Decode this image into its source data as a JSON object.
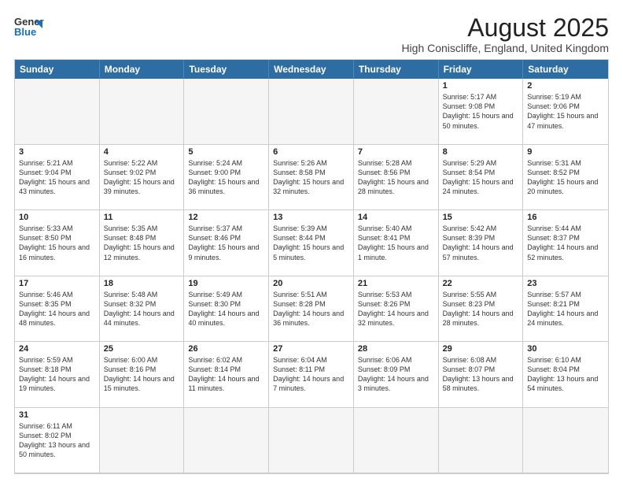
{
  "header": {
    "logo_line1": "General",
    "logo_line2": "Blue",
    "main_title": "August 2025",
    "subtitle": "High Coniscliffe, England, United Kingdom"
  },
  "day_headers": [
    "Sunday",
    "Monday",
    "Tuesday",
    "Wednesday",
    "Thursday",
    "Friday",
    "Saturday"
  ],
  "cells": [
    {
      "day": "",
      "info": "",
      "empty": true
    },
    {
      "day": "",
      "info": "",
      "empty": true
    },
    {
      "day": "",
      "info": "",
      "empty": true
    },
    {
      "day": "",
      "info": "",
      "empty": true
    },
    {
      "day": "",
      "info": "",
      "empty": true
    },
    {
      "day": "1",
      "info": "Sunrise: 5:17 AM\nSunset: 9:08 PM\nDaylight: 15 hours and 50 minutes."
    },
    {
      "day": "2",
      "info": "Sunrise: 5:19 AM\nSunset: 9:06 PM\nDaylight: 15 hours and 47 minutes."
    },
    {
      "day": "3",
      "info": "Sunrise: 5:21 AM\nSunset: 9:04 PM\nDaylight: 15 hours and 43 minutes."
    },
    {
      "day": "4",
      "info": "Sunrise: 5:22 AM\nSunset: 9:02 PM\nDaylight: 15 hours and 39 minutes."
    },
    {
      "day": "5",
      "info": "Sunrise: 5:24 AM\nSunset: 9:00 PM\nDaylight: 15 hours and 36 minutes."
    },
    {
      "day": "6",
      "info": "Sunrise: 5:26 AM\nSunset: 8:58 PM\nDaylight: 15 hours and 32 minutes."
    },
    {
      "day": "7",
      "info": "Sunrise: 5:28 AM\nSunset: 8:56 PM\nDaylight: 15 hours and 28 minutes."
    },
    {
      "day": "8",
      "info": "Sunrise: 5:29 AM\nSunset: 8:54 PM\nDaylight: 15 hours and 24 minutes."
    },
    {
      "day": "9",
      "info": "Sunrise: 5:31 AM\nSunset: 8:52 PM\nDaylight: 15 hours and 20 minutes."
    },
    {
      "day": "10",
      "info": "Sunrise: 5:33 AM\nSunset: 8:50 PM\nDaylight: 15 hours and 16 minutes."
    },
    {
      "day": "11",
      "info": "Sunrise: 5:35 AM\nSunset: 8:48 PM\nDaylight: 15 hours and 12 minutes."
    },
    {
      "day": "12",
      "info": "Sunrise: 5:37 AM\nSunset: 8:46 PM\nDaylight: 15 hours and 9 minutes."
    },
    {
      "day": "13",
      "info": "Sunrise: 5:39 AM\nSunset: 8:44 PM\nDaylight: 15 hours and 5 minutes."
    },
    {
      "day": "14",
      "info": "Sunrise: 5:40 AM\nSunset: 8:41 PM\nDaylight: 15 hours and 1 minute."
    },
    {
      "day": "15",
      "info": "Sunrise: 5:42 AM\nSunset: 8:39 PM\nDaylight: 14 hours and 57 minutes."
    },
    {
      "day": "16",
      "info": "Sunrise: 5:44 AM\nSunset: 8:37 PM\nDaylight: 14 hours and 52 minutes."
    },
    {
      "day": "17",
      "info": "Sunrise: 5:46 AM\nSunset: 8:35 PM\nDaylight: 14 hours and 48 minutes."
    },
    {
      "day": "18",
      "info": "Sunrise: 5:48 AM\nSunset: 8:32 PM\nDaylight: 14 hours and 44 minutes."
    },
    {
      "day": "19",
      "info": "Sunrise: 5:49 AM\nSunset: 8:30 PM\nDaylight: 14 hours and 40 minutes."
    },
    {
      "day": "20",
      "info": "Sunrise: 5:51 AM\nSunset: 8:28 PM\nDaylight: 14 hours and 36 minutes."
    },
    {
      "day": "21",
      "info": "Sunrise: 5:53 AM\nSunset: 8:26 PM\nDaylight: 14 hours and 32 minutes."
    },
    {
      "day": "22",
      "info": "Sunrise: 5:55 AM\nSunset: 8:23 PM\nDaylight: 14 hours and 28 minutes."
    },
    {
      "day": "23",
      "info": "Sunrise: 5:57 AM\nSunset: 8:21 PM\nDaylight: 14 hours and 24 minutes."
    },
    {
      "day": "24",
      "info": "Sunrise: 5:59 AM\nSunset: 8:18 PM\nDaylight: 14 hours and 19 minutes."
    },
    {
      "day": "25",
      "info": "Sunrise: 6:00 AM\nSunset: 8:16 PM\nDaylight: 14 hours and 15 minutes."
    },
    {
      "day": "26",
      "info": "Sunrise: 6:02 AM\nSunset: 8:14 PM\nDaylight: 14 hours and 11 minutes."
    },
    {
      "day": "27",
      "info": "Sunrise: 6:04 AM\nSunset: 8:11 PM\nDaylight: 14 hours and 7 minutes."
    },
    {
      "day": "28",
      "info": "Sunrise: 6:06 AM\nSunset: 8:09 PM\nDaylight: 14 hours and 3 minutes."
    },
    {
      "day": "29",
      "info": "Sunrise: 6:08 AM\nSunset: 8:07 PM\nDaylight: 13 hours and 58 minutes."
    },
    {
      "day": "30",
      "info": "Sunrise: 6:10 AM\nSunset: 8:04 PM\nDaylight: 13 hours and 54 minutes."
    },
    {
      "day": "31",
      "info": "Sunrise: 6:11 AM\nSunset: 8:02 PM\nDaylight: 13 hours and 50 minutes."
    },
    {
      "day": "",
      "info": "",
      "empty": true
    },
    {
      "day": "",
      "info": "",
      "empty": true
    },
    {
      "day": "",
      "info": "",
      "empty": true
    },
    {
      "day": "",
      "info": "",
      "empty": true
    },
    {
      "day": "",
      "info": "",
      "empty": true
    },
    {
      "day": "",
      "info": "",
      "empty": true
    }
  ]
}
